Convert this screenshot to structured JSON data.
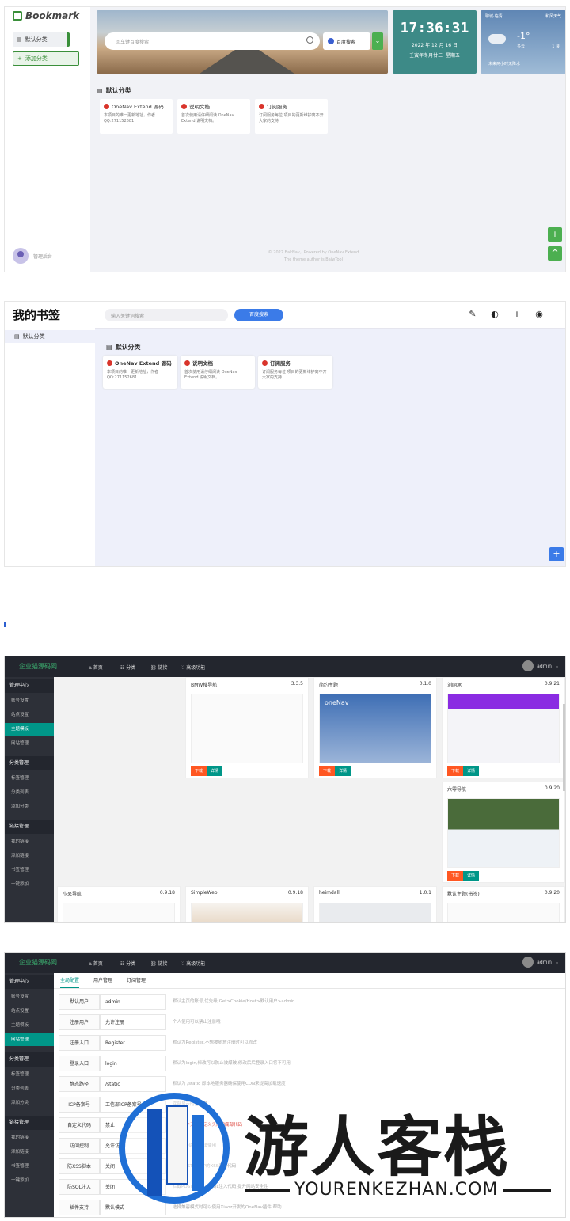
{
  "p1": {
    "logo": "Bookmark",
    "sidebar": [
      "默认分类",
      "添加分类"
    ],
    "search_placeholder": "回车键百度搜索",
    "engine": "百度搜索",
    "clock": {
      "time": "17:36:31",
      "date": "2022 年 12 月 16 日",
      "lunar": "壬寅年冬月廿三",
      "weekday": "星期五"
    },
    "weather": {
      "city": "聊城·临清",
      "src": "和风天气",
      "temp": "-1°",
      "desc": "多云",
      "aqi": "1 良",
      "forecast": "未来两小时无降水"
    },
    "category": "默认分类",
    "cards": [
      {
        "title": "OneNav Extend 源码",
        "desc": "本项目的唯一更新地址，作者QQ:271152681"
      },
      {
        "title": "说明文档",
        "desc": "首次使用请仔细阅读 OneNav Extend 说明文档。"
      },
      {
        "title": "订阅服务",
        "desc": "订阅服务每位 项目的更新维护离不开大家的支持"
      }
    ],
    "user": "管理后台",
    "footer": [
      "© 2022 BakNav，Powered by OneNav Extend",
      "The theme author is BaiwTool"
    ],
    "fab": [
      "+",
      "^"
    ]
  },
  "p2": {
    "logo": "我的书签",
    "sidebar": "默认分类",
    "search_placeholder": "输入关键词搜索",
    "search_button": "百度搜索",
    "category": "默认分类",
    "cards": [
      {
        "title": "OneNav Extend 源码",
        "desc": "本项目的唯一更新地址，作者QQ:271152681"
      },
      {
        "title": "说明文档",
        "desc": "首次使用请仔细阅读 OneNav Extend 说明文档。"
      },
      {
        "title": "订阅服务",
        "desc": "订阅服务每位 项目的更新维护离不开大家的支持"
      }
    ],
    "top_icons": [
      "✎",
      "◐",
      "+",
      "◉"
    ],
    "fab": "+"
  },
  "admin": {
    "brand": "企业猫源码网",
    "nav": [
      "首页",
      "分类",
      "链接",
      "高级功能"
    ],
    "user": "admin",
    "groups": [
      {
        "title": "管理中心",
        "items": [
          "账号设置",
          "站点设置",
          "主题模板",
          "网站管理"
        ]
      },
      {
        "title": "分类管理",
        "items": [
          "标签管理",
          "分类列表",
          "添加分类"
        ]
      },
      {
        "title": "链接管理",
        "items": [
          "我的链接",
          "添加链接",
          "书签管理",
          "一键添加"
        ]
      }
    ]
  },
  "p3": {
    "themes": [
      {
        "name": "BMW搜导航",
        "ver": "3.3.5"
      },
      {
        "name": "简约主题",
        "ver": "0.1.0"
      },
      {
        "name": "刘网承",
        "ver": "0.9.21"
      },
      {
        "name": "六零导航",
        "ver": "0.9.20"
      },
      {
        "name": "小呆导航",
        "ver": "0.9.18"
      },
      {
        "name": "SimpleWeb",
        "ver": "0.9.18"
      },
      {
        "name": "heimdall",
        "ver": "1.0.1"
      },
      {
        "name": "默认主题(书签)",
        "ver": "0.9.20"
      }
    ],
    "btn_download": "下载",
    "btn_detail": "详情",
    "onenav_label": "oneNav"
  },
  "p4": {
    "tabs": [
      "全局配置",
      "用户管理",
      "订阅管理"
    ],
    "rows": [
      {
        "label": "默认用户",
        "value": "admin",
        "tip": "默认主页的账号,优先级:Get>Cookie/Host>默认用户>admin"
      },
      {
        "label": "注册用户",
        "value": "允许注册",
        "tip": "个人使用可以禁止注册哦"
      },
      {
        "label": "注册入口",
        "value": "Register",
        "tip": "默认为Register,不想被随意注册时可以修改"
      },
      {
        "label": "登录入口",
        "value": "login",
        "tip": "默认为login,修改可以防止被爆破,修改后后登录入口将不可用"
      },
      {
        "label": "静态路径",
        "value": "/static",
        "tip": "默认为 /static 即本地服务器确保使用CDN来提高加载速度"
      },
      {
        "label": "ICP备案号",
        "value": "工信部ICP备案号",
        "tip": "底部显示的备案号"
      },
      {
        "label": "自定义代码",
        "value": "禁止",
        "tip": "普通用户无法自定义头部和底部代码"
      },
      {
        "label": "访问控制",
        "value": "允许访问",
        "tip": "禁止访问后将无法使用"
      },
      {
        "label": "防XSS脚本",
        "value": "关闭",
        "tip": "拦截POST表单中的XSS恶意代码"
      },
      {
        "label": "防SQL注入",
        "value": "关闭",
        "tip": "拦截POST表单中的SQL注入代码,提升网站安全性"
      },
      {
        "label": "插件支持",
        "value": "默认模式",
        "tip": "选择兼容模式时可以使用Xiaoz开发的OneNav插件 帮助"
      }
    ]
  },
  "watermark": {
    "cn": "游人客栈",
    "en": "YOURENKEZHAN.COM"
  }
}
